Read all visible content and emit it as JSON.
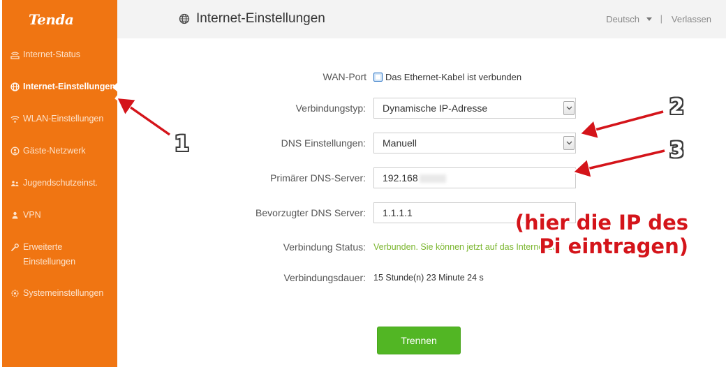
{
  "brand": {
    "logo_text": "Tenda"
  },
  "sidebar": {
    "items": [
      {
        "label": "Internet-Status",
        "icon": "router-icon",
        "active": false
      },
      {
        "label": "Internet-Einstellungen",
        "icon": "globe-icon",
        "active": true
      },
      {
        "label": "WLAN-Einstellungen",
        "icon": "wifi-icon",
        "active": false
      },
      {
        "label": "Gäste-Netzwerk",
        "icon": "guest-network-icon",
        "active": false
      },
      {
        "label": "Jugendschutzeinst.",
        "icon": "parental-control-icon",
        "active": false
      },
      {
        "label": "VPN",
        "icon": "vpn-user-icon",
        "active": false
      },
      {
        "label": "Erweiterte Einstellungen",
        "icon": "wrench-icon",
        "active": false
      },
      {
        "label": "Systemeinstellungen",
        "icon": "gear-icon",
        "active": false
      }
    ]
  },
  "header": {
    "title": "Internet-Einstellungen",
    "title_icon": "globe-icon",
    "language": "Deutsch",
    "separator": "|",
    "logout": "Verlassen"
  },
  "form": {
    "wan_port": {
      "label": "WAN-Port",
      "value": "Das Ethernet-Kabel ist verbunden"
    },
    "connection_type": {
      "label": "Verbindungstyp:",
      "value": "Dynamische IP-Adresse"
    },
    "dns_settings": {
      "label": "DNS Einstellungen:",
      "value": "Manuell"
    },
    "primary_dns": {
      "label": "Primärer DNS-Server:",
      "value": "192.168"
    },
    "preferred_dns": {
      "label": "Bevorzugter DNS Server:",
      "value": "1.1.1.1"
    },
    "connection_status": {
      "label": "Verbindung Status:",
      "value": "Verbunden. Sie können jetzt auf das Internet zu"
    },
    "connection_duration": {
      "label": "Verbindungsdauer:",
      "value": "15 Stunde(n) 23 Minute 24 s"
    },
    "disconnect_button": "Trennen"
  },
  "annotations": {
    "markers": [
      "1",
      "2",
      "3"
    ],
    "note_line1": "(hier die IP des",
    "note_line2": "Pi eintragen)",
    "color_arrow": "#d4141a",
    "color_text": "#d4141a"
  },
  "colors": {
    "sidebar": "#f07512",
    "header_bg": "#f3f3f3",
    "status_green": "#7bb62f",
    "button_green": "#52b624"
  }
}
